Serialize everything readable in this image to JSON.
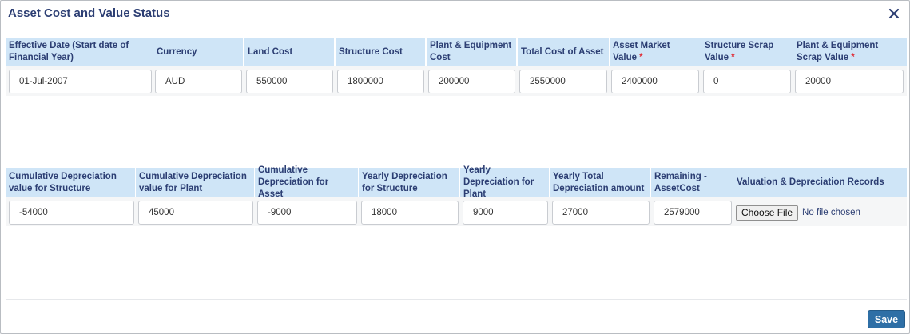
{
  "dialog": {
    "title": "Asset Cost and Value Status",
    "close_icon": "close-icon"
  },
  "section1": {
    "columns": [
      {
        "key": "effective_date",
        "label": "Effective Date (Start date of Financial Year)",
        "required": false,
        "value": "01-Jul-2007"
      },
      {
        "key": "currency",
        "label": "Currency",
        "required": false,
        "value": "AUD"
      },
      {
        "key": "land_cost",
        "label": "Land Cost",
        "required": false,
        "value": "550000"
      },
      {
        "key": "structure_cost",
        "label": "Structure Cost",
        "required": false,
        "value": "1800000"
      },
      {
        "key": "plant_equipment_cost",
        "label": "Plant & Equipment Cost",
        "required": false,
        "value": "200000"
      },
      {
        "key": "total_cost_of_asset",
        "label": "Total Cost of Asset",
        "required": false,
        "value": "2550000"
      },
      {
        "key": "asset_market_value",
        "label": "Asset Market Value",
        "required": true,
        "value": "2400000"
      },
      {
        "key": "structure_scrap_value",
        "label": "Structure Scrap Value",
        "required": true,
        "value": "0"
      },
      {
        "key": "plant_equipment_scrap_value",
        "label": "Plant & Equipment Scrap Value",
        "required": true,
        "value": "20000"
      }
    ]
  },
  "section2": {
    "columns": [
      {
        "key": "cum_dep_structure",
        "label": "Cumulative Depreciation value for Structure",
        "value": "-54000"
      },
      {
        "key": "cum_dep_plant",
        "label": "Cumulative Depreciation value for Plant",
        "value": "45000"
      },
      {
        "key": "cum_dep_asset",
        "label": "Cumulative Depreciation for Asset",
        "value": "-9000"
      },
      {
        "key": "yearly_dep_structure",
        "label": "Yearly Depreciation for Structure",
        "value": "18000"
      },
      {
        "key": "yearly_dep_plant",
        "label": "Yearly Depreciation for Plant",
        "value": "9000"
      },
      {
        "key": "yearly_total_dep",
        "label": "Yearly Total Depreciation amount",
        "value": "27000"
      },
      {
        "key": "remaining_asset_cost",
        "label": "Remaining - AssetCost",
        "value": "2579000"
      },
      {
        "key": "valuation_records",
        "label": "Valuation & Depreciation Records",
        "file_button": "Choose File",
        "file_status": "No file chosen"
      }
    ]
  },
  "required_mark": "*",
  "footer": {
    "save_label": "Save"
  },
  "colors": {
    "header_bg": "#cfe5f7",
    "header_text": "#2c3e73",
    "accent": "#2e6fa6",
    "required": "#e0303a"
  }
}
